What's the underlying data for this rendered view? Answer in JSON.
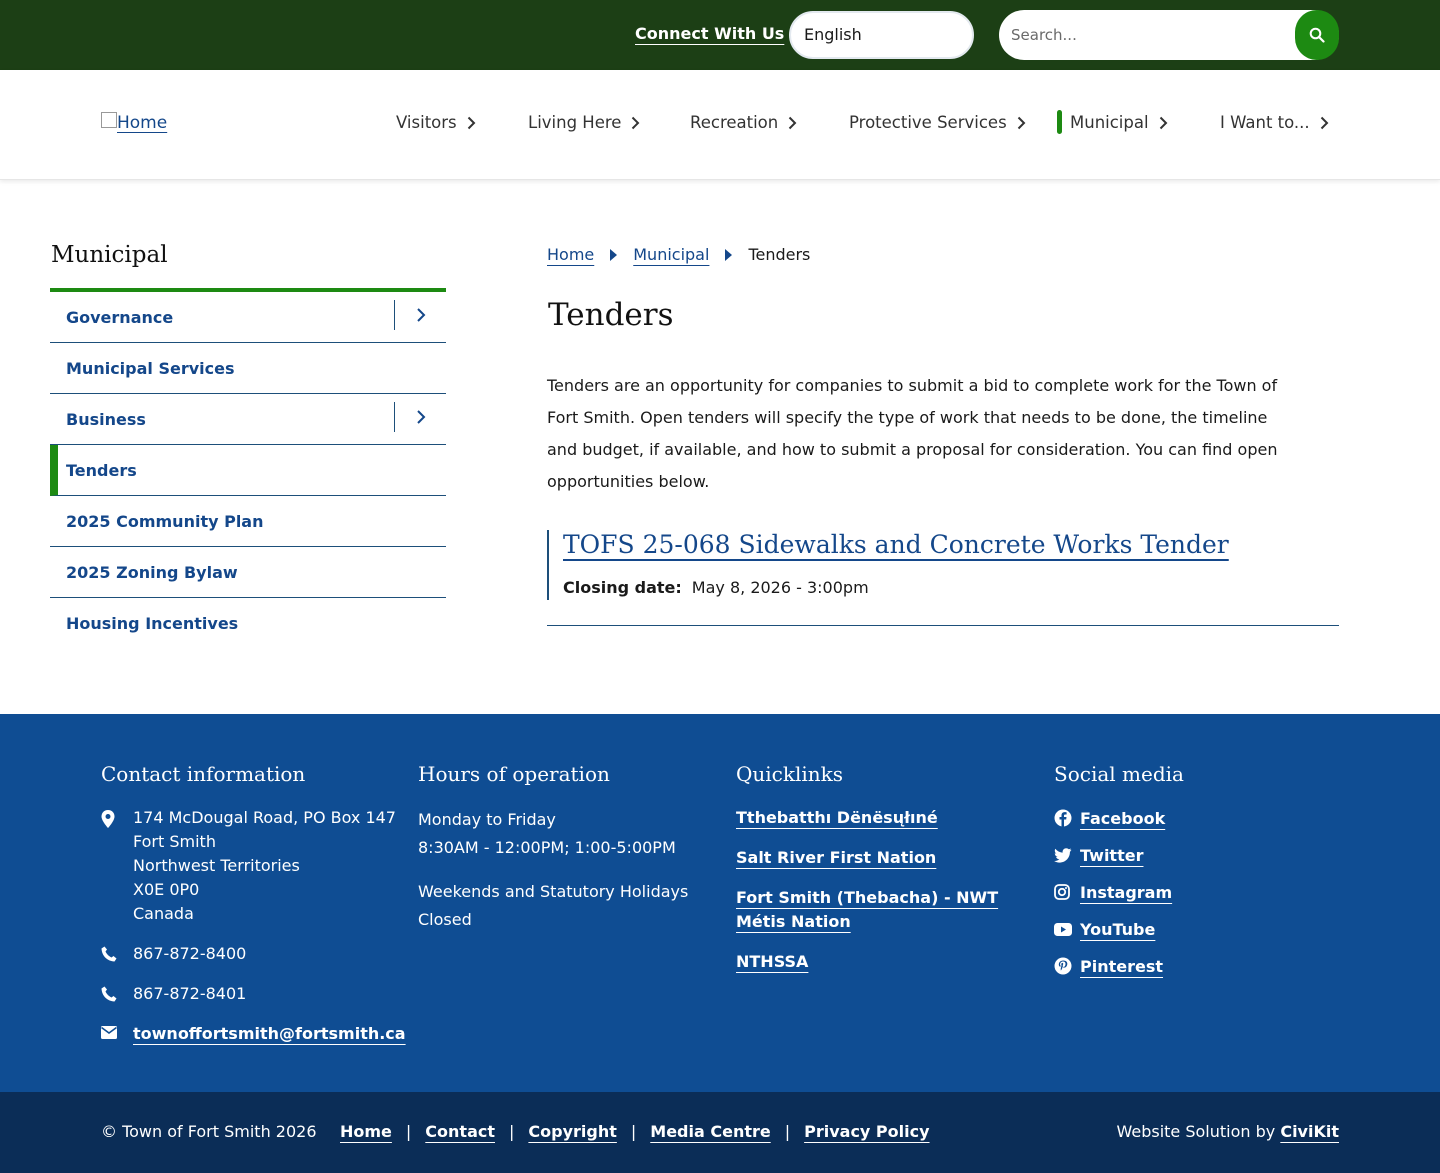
{
  "colors": {
    "topbar": "#1c3f15",
    "accent_green": "#1d8a12",
    "link_blue": "#14478a",
    "footer_blue": "#0f4d93",
    "bottom_bar": "#0b2d57"
  },
  "topbar": {
    "connect_label": "Connect With Us",
    "language_value": "English",
    "search_placeholder": "Search...",
    "search_icon": "search-icon"
  },
  "header": {
    "logo_alt": "Home",
    "nav": [
      {
        "label": "Visitors"
      },
      {
        "label": "Living Here"
      },
      {
        "label": "Recreation"
      },
      {
        "label": "Protective Services"
      },
      {
        "label": "Municipal",
        "active": true
      },
      {
        "label": "I Want to..."
      }
    ]
  },
  "sidebar": {
    "title": "Municipal",
    "items": [
      {
        "label": "Governance",
        "expandable": true
      },
      {
        "label": "Municipal Services"
      },
      {
        "label": "Business",
        "expandable": true
      },
      {
        "label": "Tenders",
        "active": true
      },
      {
        "label": "2025 Community Plan"
      },
      {
        "label": "2025 Zoning Bylaw"
      },
      {
        "label": "Housing Incentives"
      }
    ]
  },
  "breadcrumb": {
    "home": "Home",
    "section": "Municipal",
    "current": "Tenders"
  },
  "main": {
    "title": "Tenders",
    "intro": "Tenders are an opportunity for companies to submit a bid to complete work for the Town of Fort Smith. Open tenders will specify the type of work that needs to be done, the timeline and budget, if available, and how to submit a proposal for consideration. You can find open opportunities below.",
    "tenders": [
      {
        "title": "TOFS 25-068 Sidewalks and Concrete Works Tender",
        "closing_label": "Closing date:",
        "closing_date": "May 8, 2026 - 3:00pm"
      }
    ]
  },
  "footer": {
    "contact": {
      "heading": "Contact information",
      "address": [
        "174 McDougal Road, PO Box 147",
        "Fort Smith",
        "Northwest Territories",
        "X0E 0P0",
        "Canada"
      ],
      "phone": "867-872-8400",
      "fax": "867-872-8401",
      "email": "townoffortsmith@fortsmith.ca"
    },
    "hours": {
      "heading": "Hours of operation",
      "weekday_label": "Monday to Friday",
      "weekday_hours": "8:30AM - 12:00PM; 1:00-5:00PM",
      "weekend_label": "Weekends and Statutory Holidays",
      "weekend_hours": "Closed"
    },
    "quicklinks": {
      "heading": "Quicklinks",
      "items": [
        "Tthebatthı Dënësųłıné",
        "Salt River First Nation",
        "Fort Smith (Thebacha) - NWT Métis Nation",
        "NTHSSA"
      ]
    },
    "social": {
      "heading": "Social media",
      "items": [
        {
          "label": "Facebook",
          "icon": "facebook-icon"
        },
        {
          "label": "Twitter",
          "icon": "twitter-icon"
        },
        {
          "label": "Instagram",
          "icon": "instagram-icon"
        },
        {
          "label": "YouTube",
          "icon": "youtube-icon"
        },
        {
          "label": "Pinterest",
          "icon": "pinterest-icon"
        }
      ]
    }
  },
  "bottom": {
    "copyright": "© Town of Fort Smith 2026",
    "links": [
      "Home",
      "Contact",
      "Copyright",
      "Media Centre",
      "Privacy Policy"
    ],
    "credit_prefix": "Website Solution by",
    "credit_link": "CiviKit"
  }
}
